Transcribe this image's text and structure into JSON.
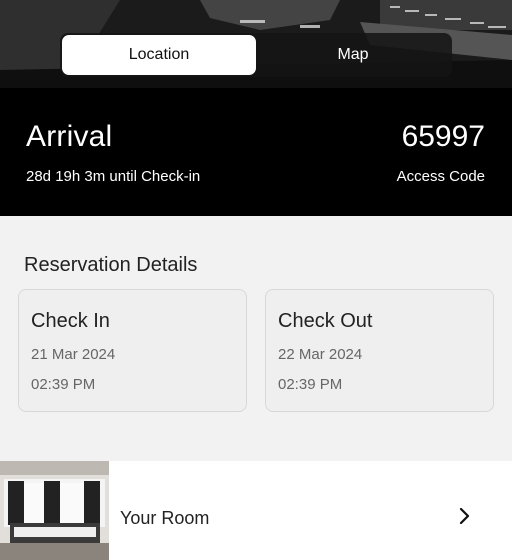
{
  "tabs": [
    {
      "label": "Location",
      "active": true
    },
    {
      "label": "Map",
      "active": false
    }
  ],
  "arrival": {
    "title": "Arrival",
    "countdown": "28d 19h 3m until Check-in",
    "access_code": "65997",
    "access_code_label": "Access Code"
  },
  "reservation": {
    "title": "Reservation Details",
    "check_in": {
      "label": "Check In",
      "date": "21 Mar 2024",
      "time": "02:39 PM"
    },
    "check_out": {
      "label": "Check Out",
      "date": "22 Mar 2024",
      "time": "02:39 PM"
    }
  },
  "room": {
    "label": "Your Room",
    "icon": "chevron-right-icon"
  },
  "colors": {
    "bar_bg": "#000000",
    "page_bg": "#f2f2f2",
    "active_tab_bg": "#ffffff"
  }
}
